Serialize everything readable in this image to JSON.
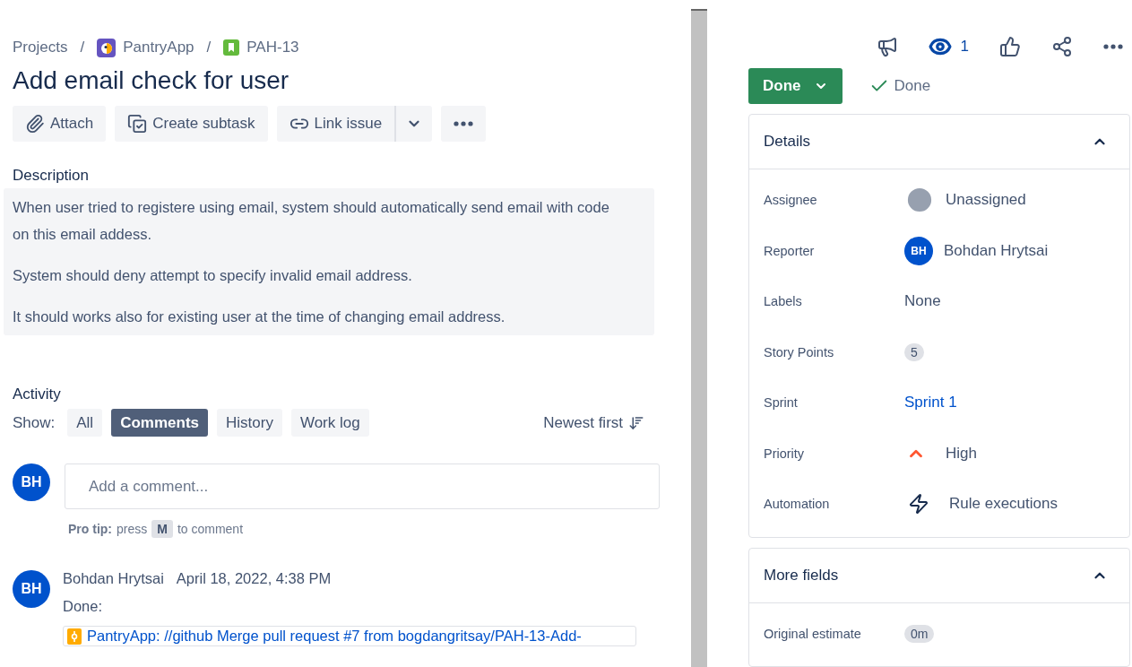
{
  "breadcrumb_separator": "/",
  "breadcrumbs": [
    {
      "label": "Projects",
      "kind": "text"
    },
    {
      "label": "PantryApp",
      "kind": "project"
    },
    {
      "label": "PAH-13",
      "kind": "issue"
    }
  ],
  "title": "Add email check for user",
  "actions": [
    {
      "label": "Attach",
      "kind": "attach"
    },
    {
      "label": "Create subtask",
      "kind": "subtask"
    },
    {
      "label": "Link issue",
      "kind": "link"
    }
  ],
  "description": {
    "heading": "Description",
    "paragraphs": [
      "When user tried to registere using email, system should automatically send email with code on this email addess.",
      "System should deny attempt to specify invalid email address.",
      "It should works also for existing user at the time of changing email address."
    ]
  },
  "activity": {
    "heading": "Activity",
    "show_label": "Show:",
    "filters": [
      {
        "label": "All",
        "selected": false
      },
      {
        "label": "Comments",
        "selected": true
      },
      {
        "label": "History",
        "selected": false
      },
      {
        "label": "Work log",
        "selected": false
      }
    ],
    "sort": "Newest first",
    "composer": {
      "initials": "BH",
      "placeholder": "Add a comment...",
      "tip_label": "Pro tip:",
      "tip_before": "press",
      "tip_key": "M",
      "tip_after": "to comment"
    },
    "comments": [
      {
        "initials": "BH",
        "author": "Bohdan Hrytsai",
        "date": "April 18, 2022, 4:38 PM",
        "text": "Done:",
        "link": "PantryApp: //github Merge pull request #7 from bogdangritsay/PAH-13-Add-"
      }
    ]
  },
  "header_actions": {
    "watchers": "1"
  },
  "status": {
    "button": "Done",
    "resolution": "Done"
  },
  "details": {
    "title": "Details",
    "expanded": true,
    "fields": [
      {
        "label": "Assignee",
        "value": "Unassigned",
        "kind": "unassigned"
      },
      {
        "label": "Reporter",
        "value": "Bohdan Hrytsai",
        "kind": "user",
        "initials": "BH"
      },
      {
        "label": "Labels",
        "value": "None",
        "kind": "text"
      },
      {
        "label": "Story Points",
        "value": "5",
        "kind": "badge"
      },
      {
        "label": "Sprint",
        "value": "Sprint 1",
        "kind": "link"
      },
      {
        "label": "Priority",
        "value": "High",
        "kind": "priority"
      },
      {
        "label": "Automation",
        "value": "Rule executions",
        "kind": "automation"
      }
    ]
  },
  "more_fields": {
    "title": "More fields",
    "expanded": true,
    "fields": [
      {
        "label": "Original estimate",
        "value": "0m",
        "kind": "badge"
      }
    ]
  }
}
